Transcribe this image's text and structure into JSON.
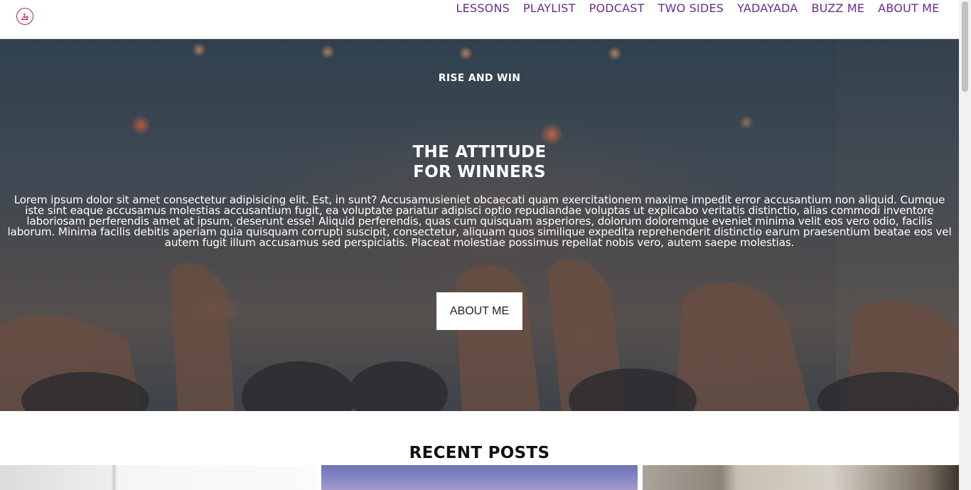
{
  "header": {
    "logo_icon": "swan-logo-icon",
    "brand_color": "#c2185b",
    "nav_color": "#6a2c91",
    "nav": [
      "LESSONS",
      "PLAYLIST",
      "PODCAST",
      "TWO SIDES",
      "YADAYADA",
      "BUZZ ME",
      "ABOUT ME"
    ]
  },
  "hero": {
    "eyebrow": "RISE AND WIN",
    "title_line1": "THE ATTITUDE",
    "title_line2": "FOR WINNERS",
    "body": "Lorem ipsum dolor sit amet consectetur adipisicing elit. Est, in sunt? Accusamusieniet obcaecati quam exercitationem maxime impedit error accusantium non aliquid. Cumque iste sint eaque accusamus molestias accusantium fugit, ea voluptate pariatur adipisci optio repudiandae voluptas ut explicabo veritatis distinctio, alias commodi inventore laboriosam perferendis amet at ipsum, deserunt esse! Aliquid perferendis, quas cum quisquam asperiores, dolorum doloremque eveniet minima velit eos vero odio, facilis laborum. Minima facilis debitis aperiam quia quisquam corrupti suscipit, consectetur, aliquam quos similique expedita reprehenderit distinctio earum praesentium beatae eos vel autem fugit illum accusamus sed perspiciatis. Placeat molestiae possimus repellat nobis vero, autem saepe molestias.",
    "button_label": "ABOUT ME"
  },
  "recent_posts": {
    "title": "RECENT POSTS"
  }
}
